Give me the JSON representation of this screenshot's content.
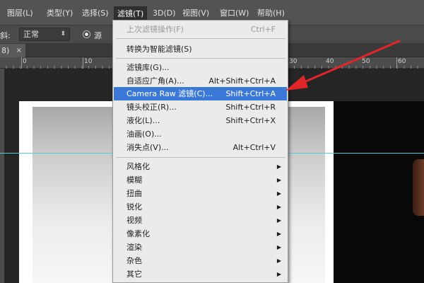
{
  "menubar": {
    "items": [
      {
        "label": "图层(L)"
      },
      {
        "label": "类型(Y)"
      },
      {
        "label": "选择(S)"
      },
      {
        "label": "滤镜(T)"
      },
      {
        "label": "3D(D)"
      },
      {
        "label": "视图(V)"
      },
      {
        "label": "窗口(W)"
      },
      {
        "label": "帮助(H)"
      }
    ]
  },
  "options_bar": {
    "tilt_label": "斜:",
    "mode_value": "正常",
    "source_label": "源"
  },
  "document_tab": {
    "title": "8)",
    "close_symbol": "×"
  },
  "ruler": {
    "labels": [
      "0",
      "10",
      "20",
      "30",
      "40",
      "50",
      "60"
    ]
  },
  "filter_menu": {
    "items": [
      {
        "label": "上次滤镜操作(F)",
        "shortcut": "Ctrl+F",
        "disabled": true
      },
      {
        "label": "转换为智能滤镜(S)",
        "shortcut": ""
      },
      {
        "label": "滤镜库(G)...",
        "shortcut": ""
      },
      {
        "label": "自适应广角(A)...",
        "shortcut": "Alt+Shift+Ctrl+A"
      },
      {
        "label": "Camera Raw 滤镜(C)...",
        "shortcut": "Shift+Ctrl+A",
        "highlighted": true
      },
      {
        "label": "镜头校正(R)...",
        "shortcut": "Shift+Ctrl+R"
      },
      {
        "label": "液化(L)...",
        "shortcut": "Shift+Ctrl+X"
      },
      {
        "label": "油画(O)...",
        "shortcut": ""
      },
      {
        "label": "消失点(V)...",
        "shortcut": "Alt+Ctrl+V"
      },
      {
        "label": "风格化",
        "submenu": true
      },
      {
        "label": "模糊",
        "submenu": true
      },
      {
        "label": "扭曲",
        "submenu": true
      },
      {
        "label": "锐化",
        "submenu": true
      },
      {
        "label": "视频",
        "submenu": true
      },
      {
        "label": "像素化",
        "submenu": true
      },
      {
        "label": "渲染",
        "submenu": true
      },
      {
        "label": "杂色",
        "submenu": true
      },
      {
        "label": "其它",
        "submenu": true
      }
    ]
  },
  "icons": {
    "submenu_arrow": "chevron-right-icon",
    "dropdown_chevron": "chevron-updown-icon",
    "radio": "radio-selected-icon"
  },
  "colors": {
    "highlight": "#3b79d9",
    "annotation_arrow": "#e0262a",
    "guide": "#4fd0d8"
  }
}
